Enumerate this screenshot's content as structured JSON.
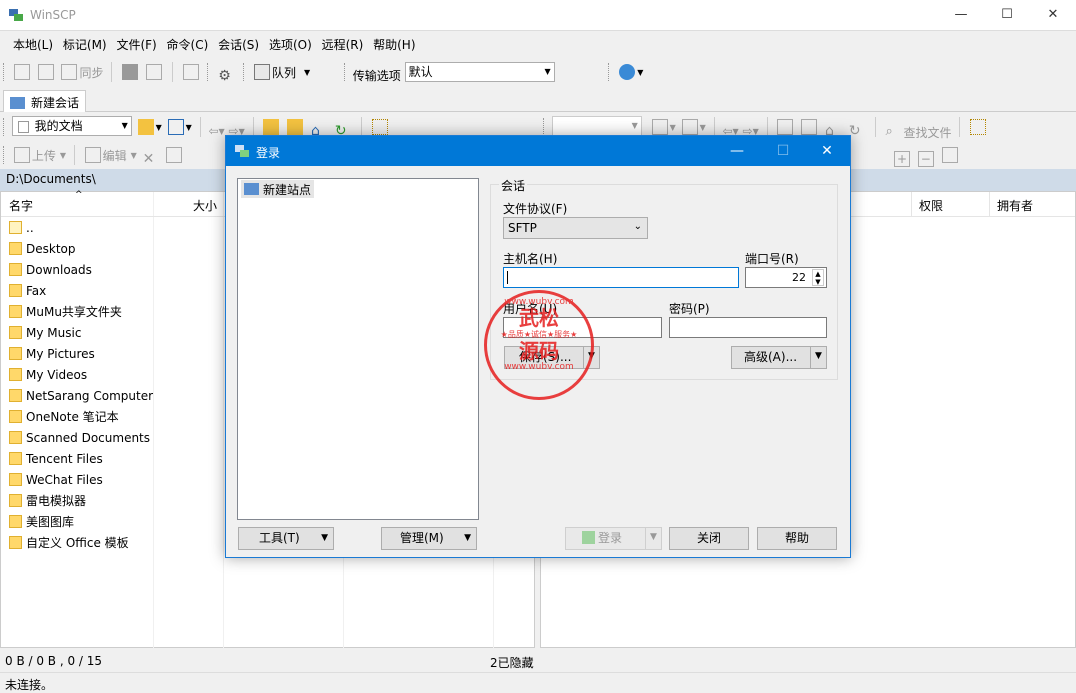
{
  "window": {
    "title": "WinSCP",
    "minimize": "—",
    "maximize": "☐",
    "close": "✕"
  },
  "menu": [
    "本地(L)",
    "标记(M)",
    "文件(F)",
    "命令(C)",
    "会话(S)",
    "选项(O)",
    "远程(R)",
    "帮助(H)"
  ],
  "toolbar": {
    "sync": "同步",
    "queue": "队列",
    "transfer_label": "传输选项",
    "transfer_value": "默认"
  },
  "tab": {
    "label": "新建会话"
  },
  "local": {
    "folder_select": "我的文档",
    "upload": "上传",
    "edit": "编辑",
    "path": "D:\\Documents\\",
    "col_name": "名字",
    "col_size": "大小",
    "items": [
      "..",
      "Desktop",
      "Downloads",
      "Fax",
      "MuMu共享文件夹",
      "My Music",
      "My Pictures",
      "My Videos",
      "NetSarang Computer",
      "OneNote 笔记本",
      "Scanned Documents",
      "Tencent Files",
      "WeChat Files",
      "雷电模拟器",
      "美图图库",
      "自定义 Office 模板"
    ]
  },
  "remote": {
    "find_files": "查找文件",
    "col_perm": "权限",
    "col_owner": "拥有者"
  },
  "status": {
    "left": "0 B / 0 B ,  0 / 15",
    "hidden": "2已隐藏",
    "connection": "未连接。"
  },
  "dialog": {
    "title": "登录",
    "site": "新建站点",
    "session_group": "会话",
    "protocol_label": "文件协议(F)",
    "protocol_value": "SFTP",
    "host_label": "主机名(H)",
    "host_value": "",
    "port_label": "端口号(R)",
    "port_value": "22",
    "user_label": "用户名(U)",
    "password_label": "密码(P)",
    "save": "保存(S)...",
    "advanced": "高级(A)...",
    "tools": "工具(T)",
    "manage": "管理(M)",
    "login": "登录",
    "close": "关闭",
    "help": "帮助"
  },
  "watermark": {
    "site": "www.wubv.com",
    "name_top": "武松",
    "name_bottom": "源码",
    "motto": "★品质★诚信★服务★"
  },
  "colors": {
    "accent": "#0078d7",
    "path_bar": "#cfdbe8",
    "stamp": "#e61e1e"
  }
}
